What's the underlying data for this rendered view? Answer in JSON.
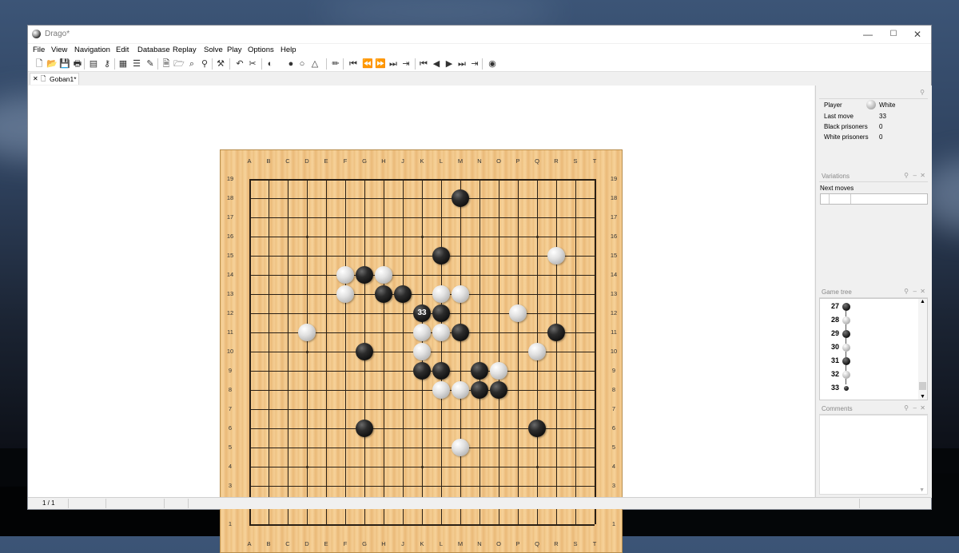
{
  "window": {
    "title": "Drago*",
    "minimize": "—",
    "maximize": "☐",
    "close": "✕"
  },
  "menu": [
    "File",
    "View",
    "Navigation",
    "Edit",
    "Database",
    "Replay",
    "Solve",
    "Play",
    "Options",
    "Help"
  ],
  "toolbar_icons": [
    {
      "name": "new-file-icon",
      "glyph": "🗋"
    },
    {
      "name": "open-folder-icon",
      "glyph": "📂"
    },
    {
      "name": "save-icon",
      "glyph": "💾"
    },
    {
      "name": "print-icon",
      "glyph": "🖶"
    },
    {
      "name": "folder-icon",
      "glyph": "▤"
    },
    {
      "name": "key-icon",
      "glyph": "⚷"
    },
    {
      "name": "game-info-icon",
      "glyph": "▦"
    },
    {
      "name": "list-icon",
      "glyph": "☰"
    },
    {
      "name": "signature-icon",
      "glyph": "✎"
    },
    {
      "name": "new-db-icon",
      "glyph": "🗎"
    },
    {
      "name": "open-db-icon",
      "glyph": "🗁"
    },
    {
      "name": "search-pattern-icon",
      "glyph": "⌕"
    },
    {
      "name": "search-icon",
      "glyph": "⚲"
    },
    {
      "name": "tools-icon",
      "glyph": "⚒"
    },
    {
      "name": "undo-icon",
      "glyph": "↶"
    },
    {
      "name": "scissors-icon",
      "glyph": "✂"
    },
    {
      "name": "stone-toggle-icon",
      "glyph": "◐"
    },
    {
      "name": "black-stone-icon",
      "glyph": "●"
    },
    {
      "name": "white-stone-icon",
      "glyph": "○"
    },
    {
      "name": "markup-icon",
      "glyph": "△"
    },
    {
      "name": "pencil-icon",
      "glyph": "✏"
    },
    {
      "name": "first-move-icon",
      "glyph": "⏮"
    },
    {
      "name": "fast-back-icon",
      "glyph": "⏪"
    },
    {
      "name": "fast-forward-icon",
      "glyph": "⏩"
    },
    {
      "name": "last-move-icon",
      "glyph": "⏭"
    },
    {
      "name": "goto-move-icon",
      "glyph": "⇥"
    },
    {
      "name": "variation-start-icon",
      "glyph": "⏮"
    },
    {
      "name": "prev-move-icon",
      "glyph": "◀"
    },
    {
      "name": "next-move-icon",
      "glyph": "▶"
    },
    {
      "name": "variation-end-icon",
      "glyph": "⏭"
    },
    {
      "name": "next-variation-icon",
      "glyph": "⇥"
    },
    {
      "name": "engine-icon",
      "glyph": "◉"
    }
  ],
  "tab": {
    "label": "Goban1*"
  },
  "board": {
    "columns": [
      "A",
      "B",
      "C",
      "D",
      "E",
      "F",
      "G",
      "H",
      "J",
      "K",
      "L",
      "M",
      "N",
      "O",
      "P",
      "Q",
      "R",
      "S",
      "T"
    ],
    "rows": [
      "19",
      "18",
      "17",
      "16",
      "15",
      "14",
      "13",
      "12",
      "11",
      "10",
      "9",
      "8",
      "7",
      "6",
      "5",
      "4",
      "3",
      "2",
      "1"
    ],
    "stones": [
      {
        "color": "black",
        "pos": "M18"
      },
      {
        "color": "black",
        "pos": "L15"
      },
      {
        "color": "white",
        "pos": "R15"
      },
      {
        "color": "white",
        "pos": "F14"
      },
      {
        "color": "black",
        "pos": "G14"
      },
      {
        "color": "white",
        "pos": "H14"
      },
      {
        "color": "white",
        "pos": "F13"
      },
      {
        "color": "black",
        "pos": "H13"
      },
      {
        "color": "black",
        "pos": "J13"
      },
      {
        "color": "white",
        "pos": "L13"
      },
      {
        "color": "white",
        "pos": "M13"
      },
      {
        "color": "black",
        "pos": "K12",
        "label": "33"
      },
      {
        "color": "black",
        "pos": "L12"
      },
      {
        "color": "white",
        "pos": "P12"
      },
      {
        "color": "white",
        "pos": "D11"
      },
      {
        "color": "white",
        "pos": "K11"
      },
      {
        "color": "white",
        "pos": "L11"
      },
      {
        "color": "black",
        "pos": "M11"
      },
      {
        "color": "black",
        "pos": "R11"
      },
      {
        "color": "black",
        "pos": "G10"
      },
      {
        "color": "white",
        "pos": "K10"
      },
      {
        "color": "white",
        "pos": "Q10"
      },
      {
        "color": "black",
        "pos": "K9"
      },
      {
        "color": "black",
        "pos": "L9"
      },
      {
        "color": "black",
        "pos": "N9"
      },
      {
        "color": "white",
        "pos": "O9"
      },
      {
        "color": "white",
        "pos": "L8"
      },
      {
        "color": "white",
        "pos": "M8"
      },
      {
        "color": "black",
        "pos": "N8"
      },
      {
        "color": "black",
        "pos": "O8"
      },
      {
        "color": "black",
        "pos": "G6"
      },
      {
        "color": "black",
        "pos": "Q6"
      },
      {
        "color": "white",
        "pos": "M5"
      }
    ]
  },
  "info": {
    "player_label": "Player",
    "player_value": "White",
    "last_move_label": "Last move",
    "last_move_value": "33",
    "black_prisoners_label": "Black prisoners",
    "black_prisoners_value": "0",
    "white_prisoners_label": "White prisoners",
    "white_prisoners_value": "0"
  },
  "variations": {
    "title": "Variations",
    "next_moves_label": "Next moves"
  },
  "game_tree": {
    "title": "Game tree",
    "moves": [
      {
        "num": "27",
        "color": "black"
      },
      {
        "num": "28",
        "color": "white"
      },
      {
        "num": "29",
        "color": "black"
      },
      {
        "num": "30",
        "color": "white"
      },
      {
        "num": "31",
        "color": "black"
      },
      {
        "num": "32",
        "color": "white"
      },
      {
        "num": "33",
        "color": "black"
      }
    ]
  },
  "comments": {
    "title": "Comments"
  },
  "status": {
    "page": "1 / 1"
  }
}
